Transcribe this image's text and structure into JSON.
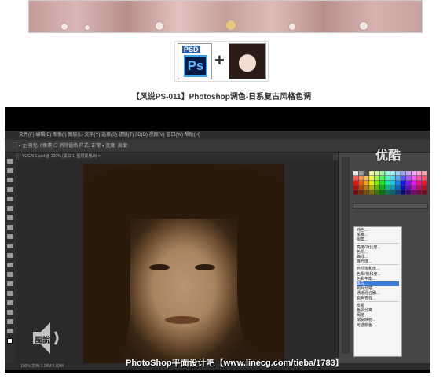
{
  "caption": "【风说PS-011】Photoshop调色-日系复古风格色调",
  "psd_icon": {
    "label": "PSD",
    "app": "Ps"
  },
  "plus_sign": "+",
  "menubar": {
    "items": "文件(F)  编辑(E)  图像(I)  图层(L)  文字(Y)  选择(S)  滤镜(T)  3D(D)  视图(V)  窗口(W)  帮助(H)"
  },
  "optionsbar": {
    "text": "⬚  ▾ ◫   羽化: 0像素   ☐ 消除锯齿   样式: 正常 ▾   宽度:        高度:"
  },
  "tabbar": {
    "text": "YUCAI 1.psd @ 100% (黑白 1, 图层蒙版/8) ×"
  },
  "statusbar": {
    "text": "100%   文档:1.08M/5.02M"
  },
  "adjust_menu": {
    "items": [
      "纯色...",
      "渐变...",
      "图案...",
      "",
      "亮度/对比度...",
      "色阶...",
      "曲线...",
      "曝光度...",
      "",
      "自然饱和度...",
      "色相/饱和度...",
      "色彩平衡...",
      "黑白...",
      "照片滤镜...",
      "通道混合器...",
      "颜色查找...",
      "",
      "反相",
      "色调分离",
      "阈值",
      "渐变映射...",
      "可选颜色..."
    ],
    "selected_index": 12
  },
  "logo_text": "优酷",
  "watermark": "PhotoShop平面设计吧【www.linecg.com/tieba/1783】",
  "speaker_text": "風說",
  "colors": {
    "ps_blue": "#061a45",
    "ps_accent": "#3fa0e6",
    "sepia": "#a9845f"
  }
}
